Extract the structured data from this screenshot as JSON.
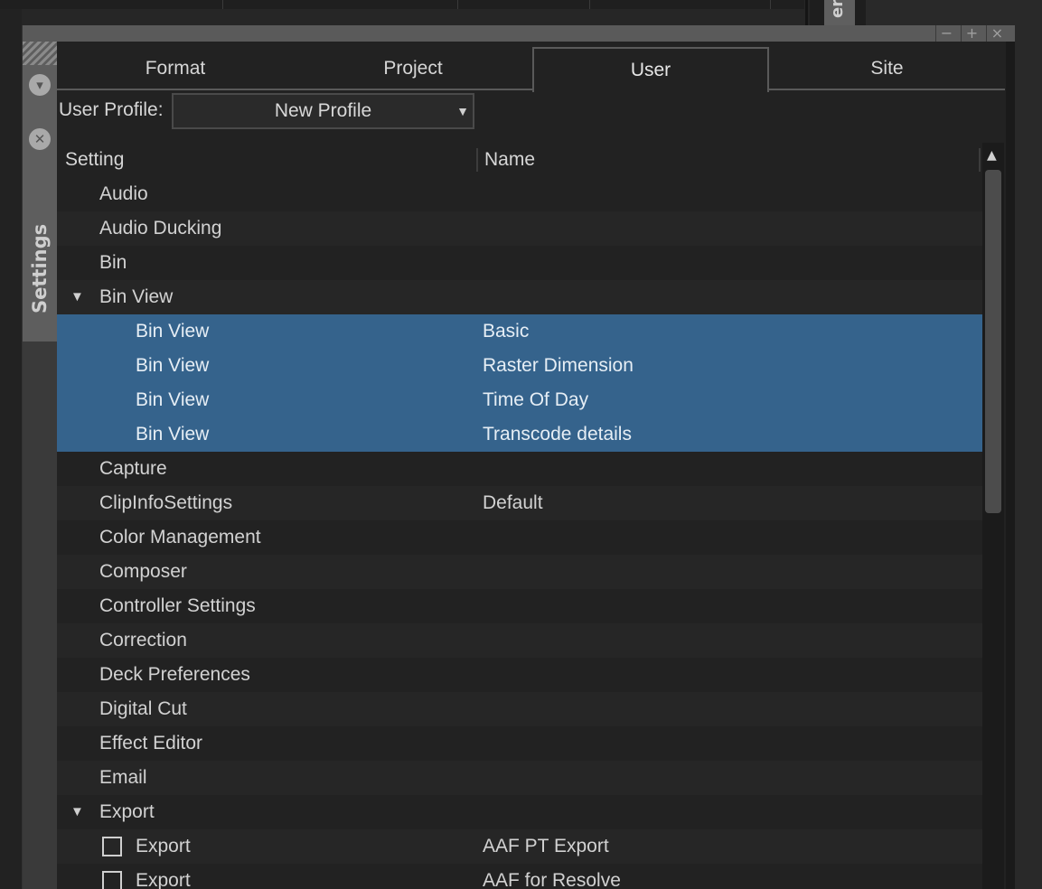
{
  "window": {
    "controls": {
      "minimize": "−",
      "maximize": "+",
      "close": "×"
    }
  },
  "background_tab": {
    "label": "er"
  },
  "sidebar": {
    "label": "Settings",
    "menu_icon": "▾",
    "close_icon": "✕"
  },
  "tabs": [
    {
      "label": "Format",
      "active": false
    },
    {
      "label": "Project",
      "active": false
    },
    {
      "label": "User",
      "active": true
    },
    {
      "label": "Site",
      "active": false
    }
  ],
  "profile": {
    "label": "User Profile:",
    "value": "New Profile",
    "arrow": "▼"
  },
  "table": {
    "columns": {
      "setting": "Setting",
      "name": "Name"
    },
    "rows": [
      {
        "setting": "Audio",
        "name": "",
        "level": 0,
        "type": "item"
      },
      {
        "setting": "Audio Ducking",
        "name": "",
        "level": 0,
        "type": "item"
      },
      {
        "setting": "Bin",
        "name": "",
        "level": 0,
        "type": "item"
      },
      {
        "setting": "Bin View",
        "name": "",
        "level": 0,
        "type": "group"
      },
      {
        "setting": "Bin View",
        "name": "Basic",
        "level": 1,
        "type": "child",
        "selected": true
      },
      {
        "setting": "Bin View",
        "name": "Raster Dimension",
        "level": 1,
        "type": "child",
        "selected": true
      },
      {
        "setting": "Bin View",
        "name": "Time Of Day",
        "level": 1,
        "type": "child",
        "selected": true
      },
      {
        "setting": "Bin View",
        "name": "Transcode details",
        "level": 1,
        "type": "child",
        "selected": true
      },
      {
        "setting": "Capture",
        "name": "",
        "level": 0,
        "type": "item"
      },
      {
        "setting": "ClipInfoSettings",
        "name": "Default",
        "level": 0,
        "type": "item"
      },
      {
        "setting": "Color Management",
        "name": "",
        "level": 0,
        "type": "item"
      },
      {
        "setting": "Composer",
        "name": "",
        "level": 0,
        "type": "item"
      },
      {
        "setting": "Controller Settings",
        "name": "",
        "level": 0,
        "type": "item"
      },
      {
        "setting": "Correction",
        "name": "",
        "level": 0,
        "type": "item"
      },
      {
        "setting": "Deck Preferences",
        "name": "",
        "level": 0,
        "type": "item"
      },
      {
        "setting": "Digital Cut",
        "name": "",
        "level": 0,
        "type": "item"
      },
      {
        "setting": "Effect Editor",
        "name": "",
        "level": 0,
        "type": "item"
      },
      {
        "setting": "Email",
        "name": "",
        "level": 0,
        "type": "item"
      },
      {
        "setting": "Export",
        "name": "",
        "level": 0,
        "type": "group"
      },
      {
        "setting": "Export",
        "name": "AAF PT Export",
        "level": 1,
        "type": "check",
        "checked": false
      },
      {
        "setting": "Export",
        "name": "AAF for Resolve",
        "level": 1,
        "type": "check",
        "checked": false
      }
    ]
  },
  "scrollbar": {
    "up_arrow": "▲"
  },
  "colors": {
    "selection": "#35638c",
    "background": "#222222",
    "sidebar": "#5e5e5e"
  }
}
